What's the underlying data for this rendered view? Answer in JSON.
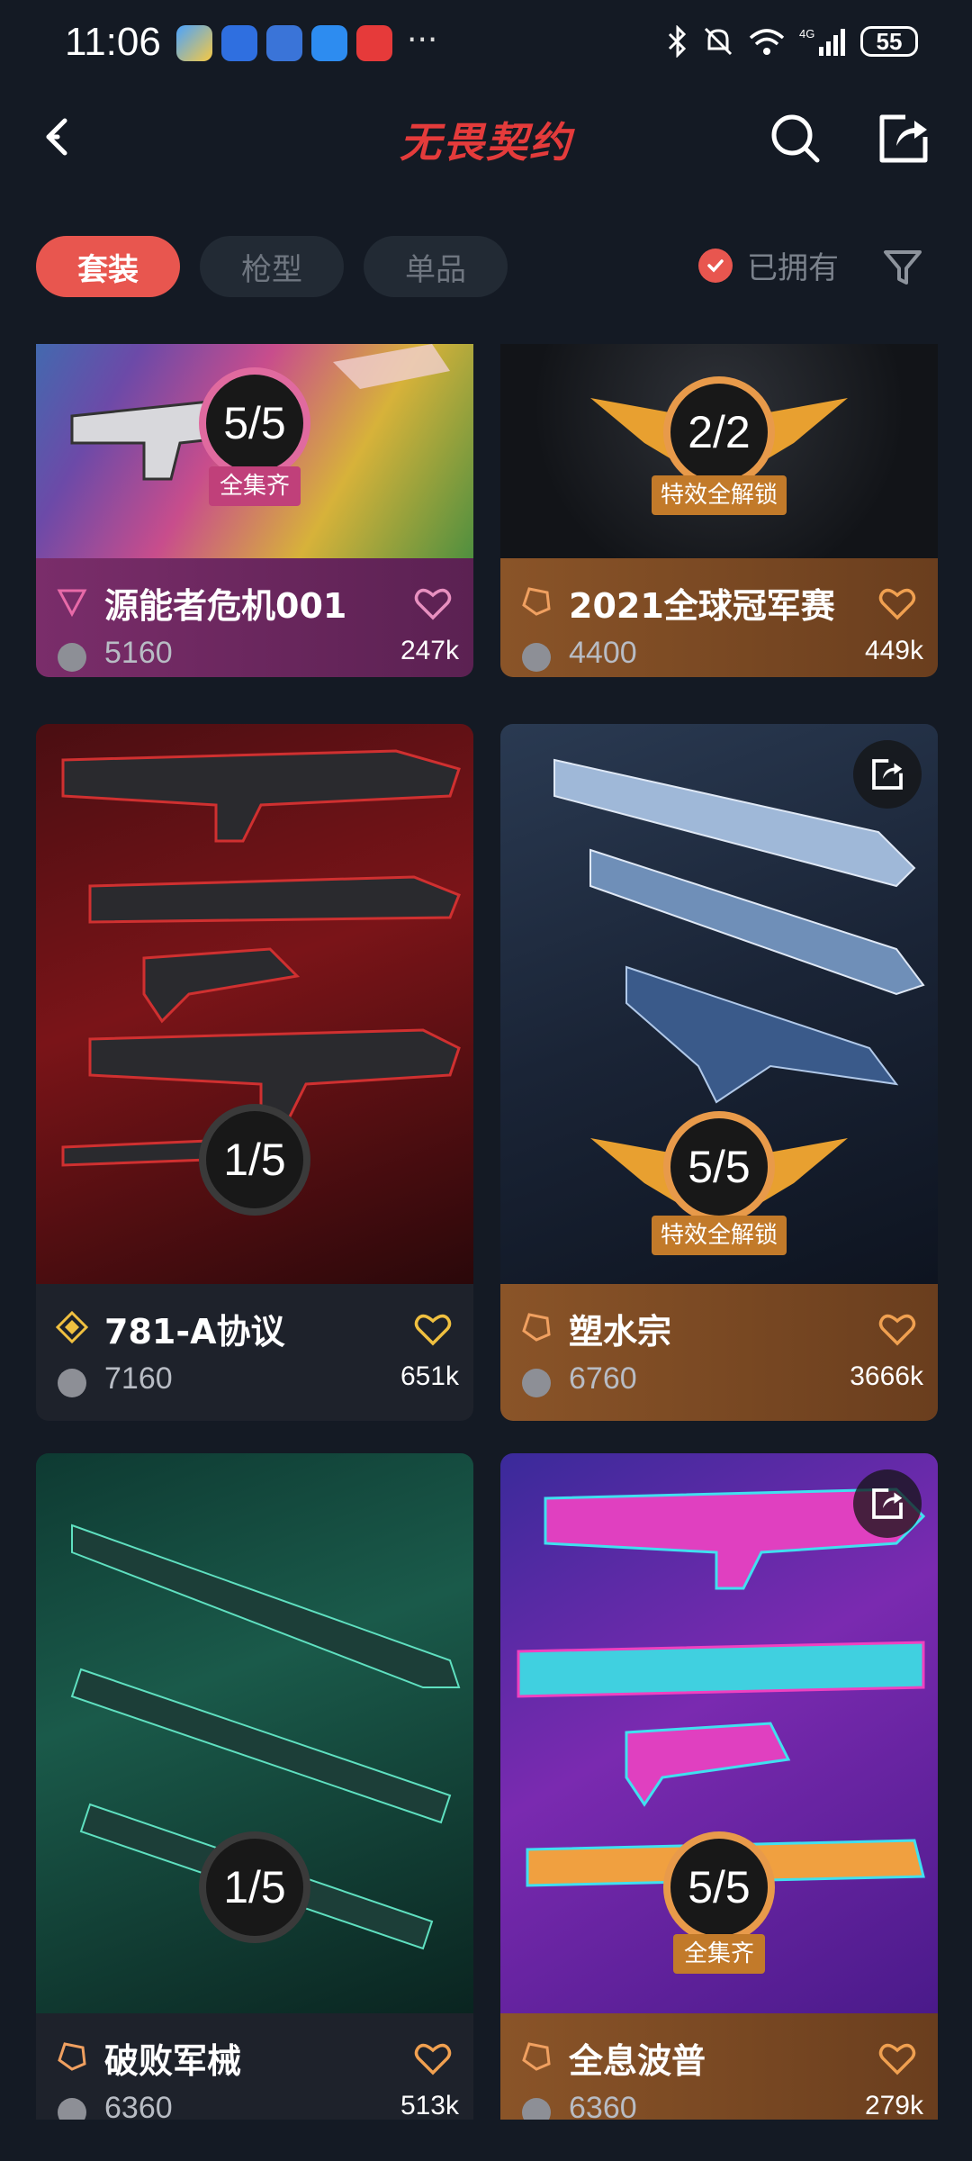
{
  "status_bar": {
    "time": "11:06",
    "battery": "55"
  },
  "header": {
    "title": "无畏契约"
  },
  "tabs": [
    {
      "label": "套装",
      "active": true
    },
    {
      "label": "枪型",
      "active": false
    },
    {
      "label": "单品",
      "active": false
    }
  ],
  "owned_filter": {
    "label": "已拥有",
    "checked": true
  },
  "cards": [
    {
      "name": "源能者危机001",
      "price": "5160",
      "likes": "247k",
      "badge": "5/5",
      "ribbon": "全集齐",
      "progress": 1.0
    },
    {
      "name": "2021全球冠军赛",
      "price": "4400",
      "likes": "449k",
      "badge": "2/2",
      "ribbon": "特效全解锁",
      "progress": 1.0
    },
    {
      "name": "781-A协议",
      "price": "7160",
      "likes": "651k",
      "badge": "1/5",
      "ribbon": "",
      "progress": 0.2
    },
    {
      "name": "塑水宗",
      "price": "6760",
      "likes": "3666k",
      "badge": "5/5",
      "ribbon": "特效全解锁",
      "progress": 1.0
    },
    {
      "name": "破败军械",
      "price": "6360",
      "likes": "513k",
      "badge": "1/5",
      "ribbon": "",
      "progress": 0.2
    },
    {
      "name": "全息波普",
      "price": "6360",
      "likes": "279k",
      "badge": "5/5",
      "ribbon": "全集齐",
      "progress": 1.0
    }
  ],
  "colors": {
    "accent": "#e8564f",
    "title_red": "#e43b3b",
    "card_purple": "#6a2a5f",
    "card_orange": "#6e4424",
    "card_dark": "#1f232c"
  }
}
